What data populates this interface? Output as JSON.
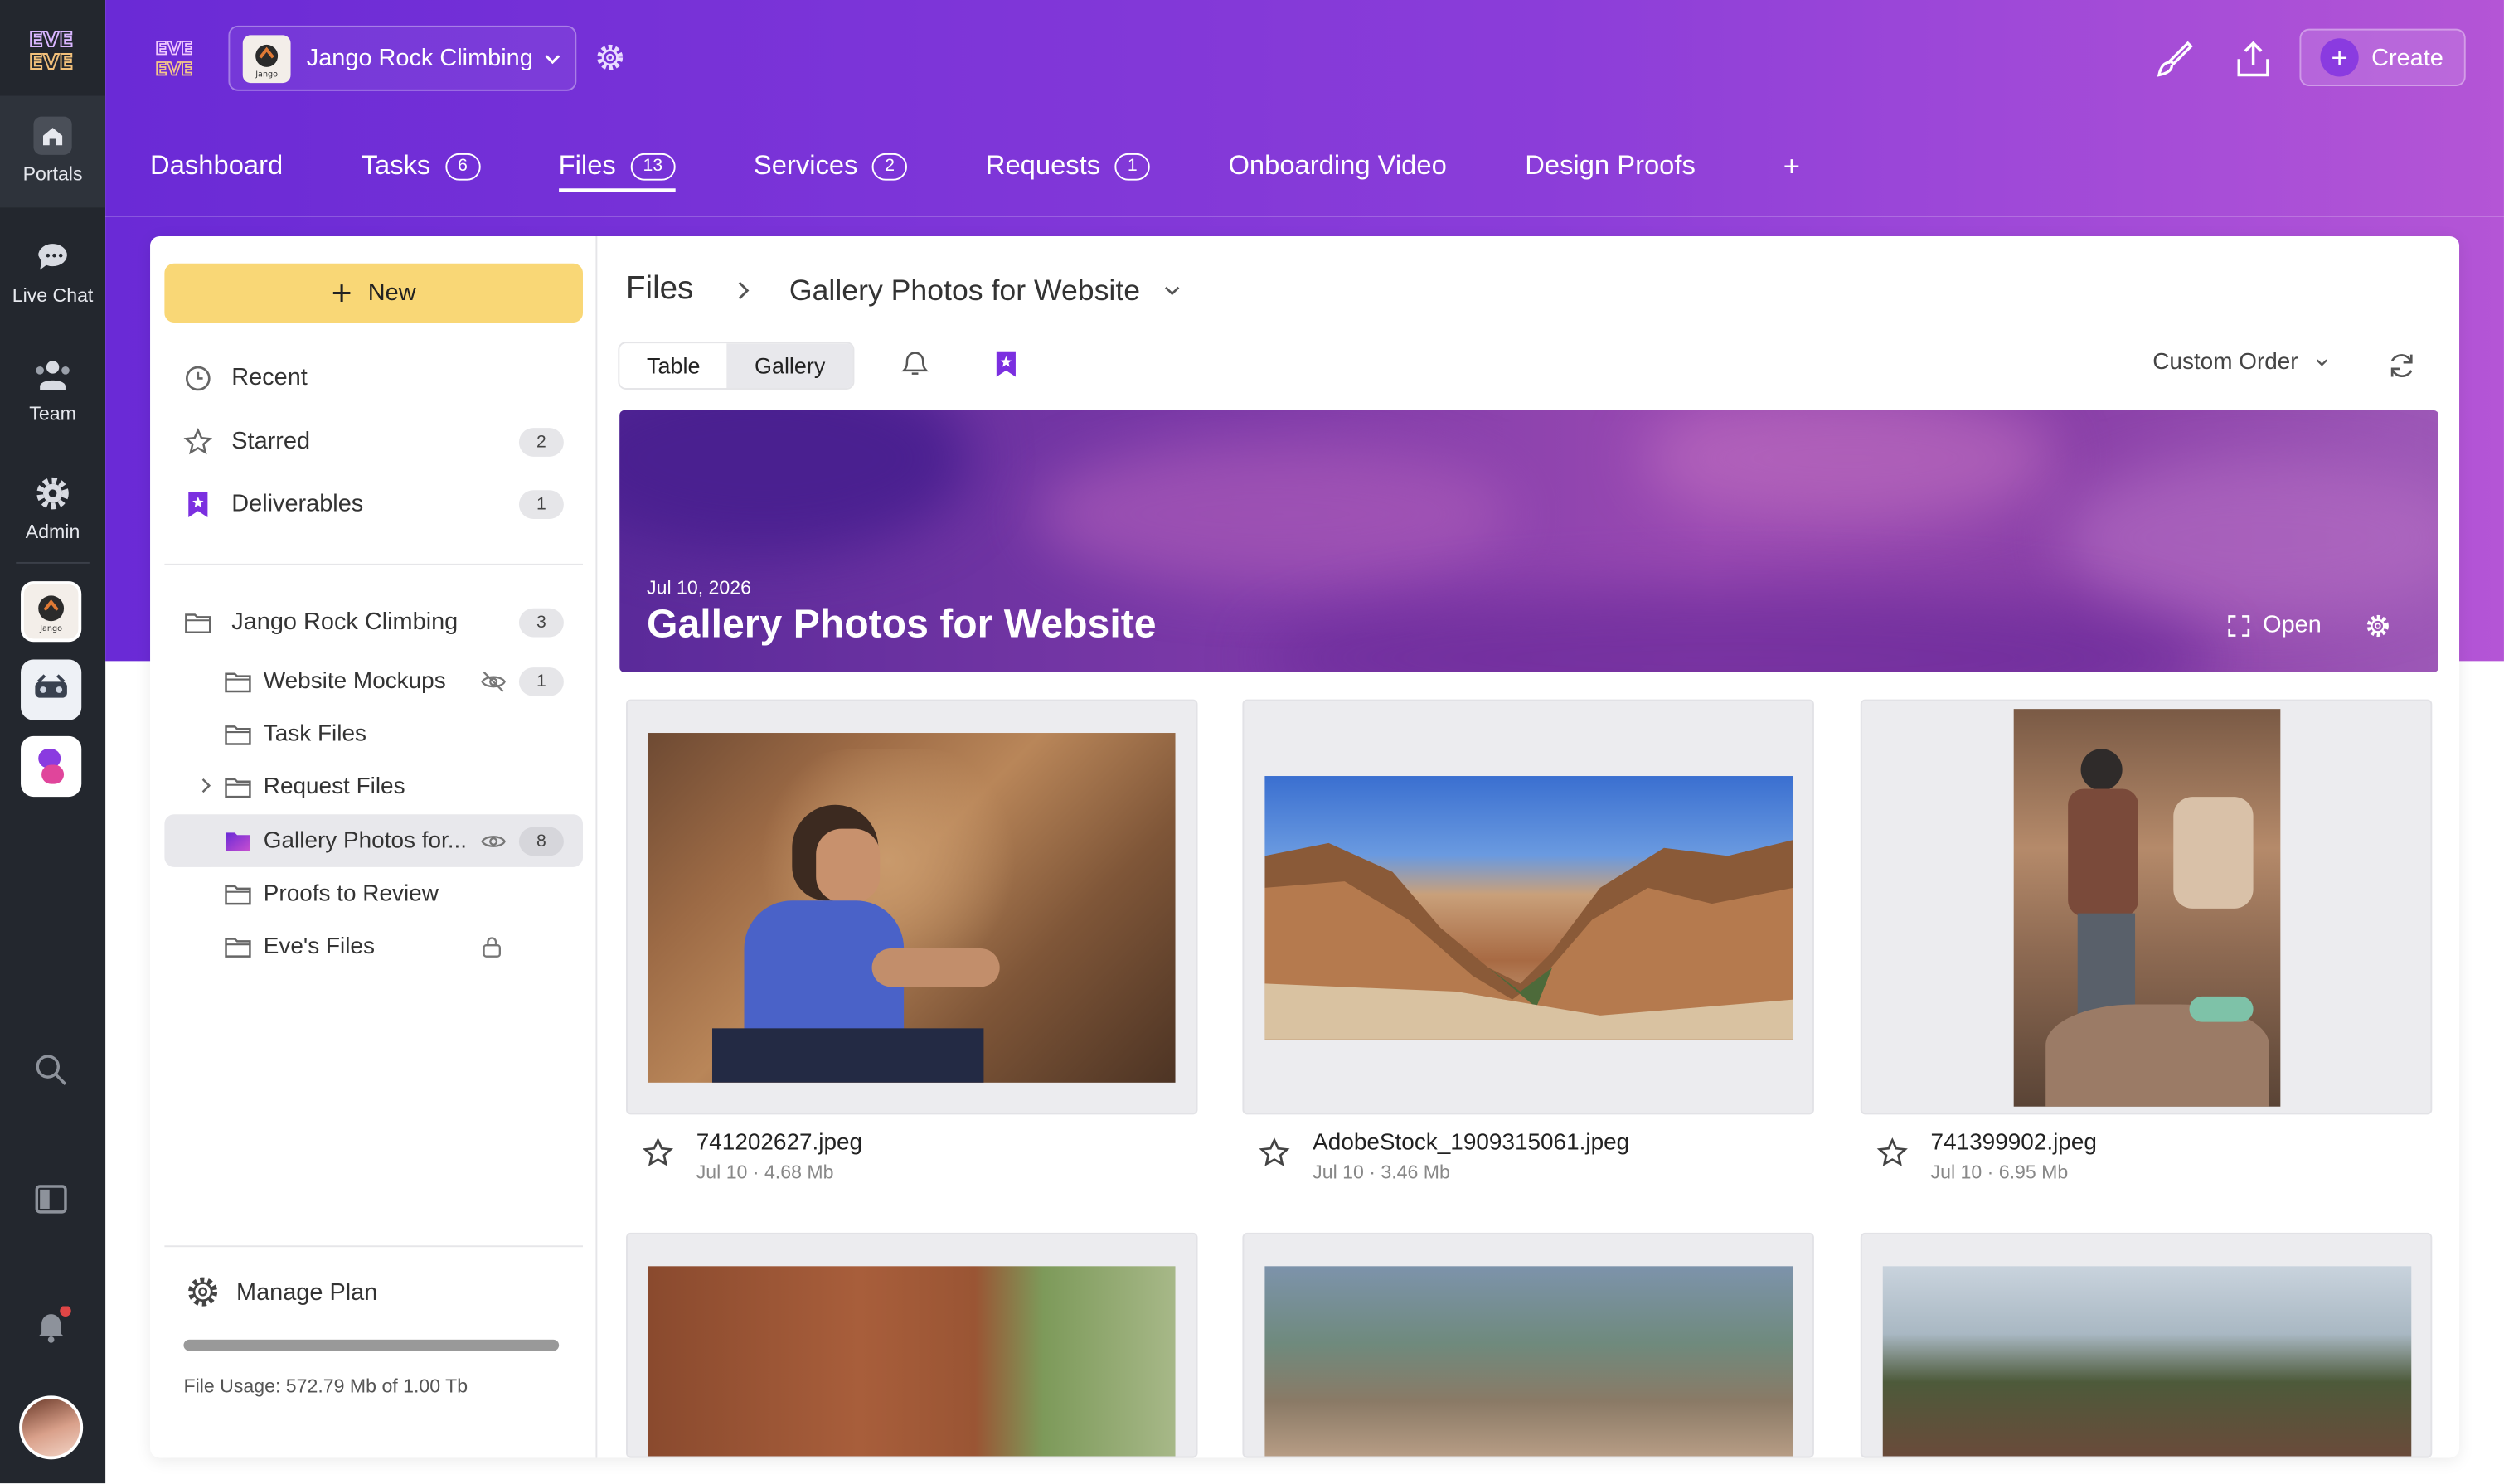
{
  "rail": {
    "items": [
      {
        "label": "Portals",
        "icon": "home-icon"
      },
      {
        "label": "Live Chat",
        "icon": "chat-icon"
      },
      {
        "label": "Team",
        "icon": "team-icon"
      },
      {
        "label": "Admin",
        "icon": "gear-icon"
      }
    ]
  },
  "header": {
    "workspace": "Jango Rock Climbing",
    "workspace_logo_text": "Jango",
    "create_label": "Create",
    "tabs": [
      {
        "label": "Dashboard",
        "count": ""
      },
      {
        "label": "Tasks",
        "count": "6"
      },
      {
        "label": "Files",
        "count": "13"
      },
      {
        "label": "Services",
        "count": "2"
      },
      {
        "label": "Requests",
        "count": "1"
      },
      {
        "label": "Onboarding Video",
        "count": ""
      },
      {
        "label": "Design Proofs",
        "count": ""
      }
    ],
    "add_tab": "+"
  },
  "sidebar": {
    "new_label": "New",
    "quick": [
      {
        "label": "Recent",
        "count": ""
      },
      {
        "label": "Starred",
        "count": "2"
      },
      {
        "label": "Deliverables",
        "count": "1"
      }
    ],
    "root_folder": {
      "label": "Jango Rock Climbing",
      "count": "3"
    },
    "folders": [
      {
        "label": "Website Mockups",
        "count": "1"
      },
      {
        "label": "Task Files",
        "count": ""
      },
      {
        "label": "Request Files",
        "count": ""
      },
      {
        "label": "Gallery Photos for...",
        "count": "8"
      },
      {
        "label": "Proofs to Review",
        "count": ""
      },
      {
        "label": "Eve's Files",
        "count": ""
      }
    ],
    "manage_label": "Manage Plan",
    "usage_text": "File Usage: 572.79 Mb of 1.00 Tb",
    "usage_fraction": 0.0006
  },
  "content": {
    "breadcrumb_root": "Files",
    "breadcrumb_current": "Gallery Photos for Website",
    "view_table": "Table",
    "view_gallery": "Gallery",
    "sort_label": "Custom Order",
    "banner": {
      "date": "Jul 10, 2026",
      "title": "Gallery Photos for Website",
      "open_label": "Open"
    },
    "files": [
      {
        "name": "741202627.jpeg",
        "info": "Jul 10 · 4.68 Mb"
      },
      {
        "name": "AdobeStock_1909315061.jpeg",
        "info": "Jul 10 · 3.46 Mb"
      },
      {
        "name": "741399902.jpeg",
        "info": "Jul 10 · 6.95 Mb"
      }
    ]
  },
  "colors": {
    "header_start": "#6a2ad6",
    "header_end": "#b455d6",
    "new_button": "#f9d776",
    "rail": "#23272e"
  }
}
